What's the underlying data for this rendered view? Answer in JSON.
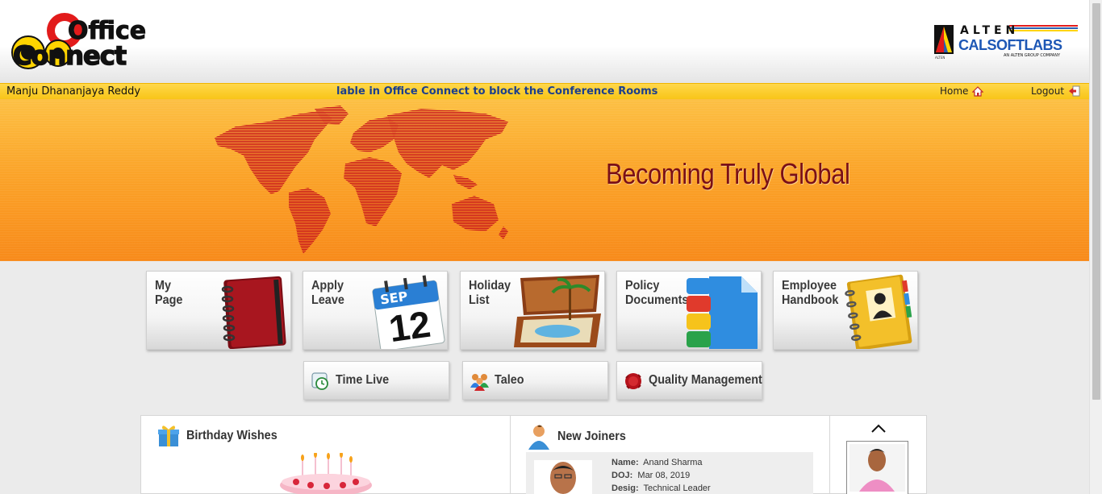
{
  "header": {
    "logo_office": "Office",
    "logo_connect": "Connect",
    "brand_alten": "ALTEN",
    "brand_calsoft": "CALSOFTLABS",
    "brand_tagline": "AN ALTEN GROUP COMPANY",
    "brand_mark_text": "ALTEN"
  },
  "topbar": {
    "user_name": "Manju Dhananjaya Reddy",
    "marquee_text": "lable in Office Connect to block the Conference Rooms",
    "home_label": "Home",
    "logout_label": "Logout"
  },
  "banner": {
    "title": "Becoming Truly Global"
  },
  "tiles": [
    {
      "line1": "My",
      "line2": "Page",
      "icon": "notebook-icon"
    },
    {
      "line1": "Apply",
      "line2": "Leave",
      "icon": "calendar-icon",
      "cal_month": "SEP",
      "cal_day": "12"
    },
    {
      "line1": "Holiday",
      "line2": "List",
      "icon": "suitcase-icon"
    },
    {
      "line1": "Policy",
      "line2": "Documents",
      "icon": "document-icon"
    },
    {
      "line1": "Employee",
      "line2": "Handbook",
      "icon": "address-book-icon"
    }
  ],
  "tiles2": [
    {
      "label": "Time Live",
      "icon": "clock-icon"
    },
    {
      "label": "Taleo",
      "icon": "people-icon"
    },
    {
      "label": "Quality Management",
      "icon": "seal-icon"
    }
  ],
  "panels": {
    "birthday_title": "Birthday Wishes",
    "joiners_title": "New Joiners",
    "joiner": {
      "name_label": "Name:",
      "name": "Anand Sharma",
      "doj_label": "DOJ:",
      "doj": "Mar 08, 2019",
      "desig_label": "Desig:",
      "desig": "Technical Leader"
    }
  },
  "colors": {
    "topbar": "#f8c518",
    "banner": "#fb9a24",
    "banner_title": "#7a0f17",
    "marquee": "#1c3f8c",
    "map": "#c8161d"
  }
}
